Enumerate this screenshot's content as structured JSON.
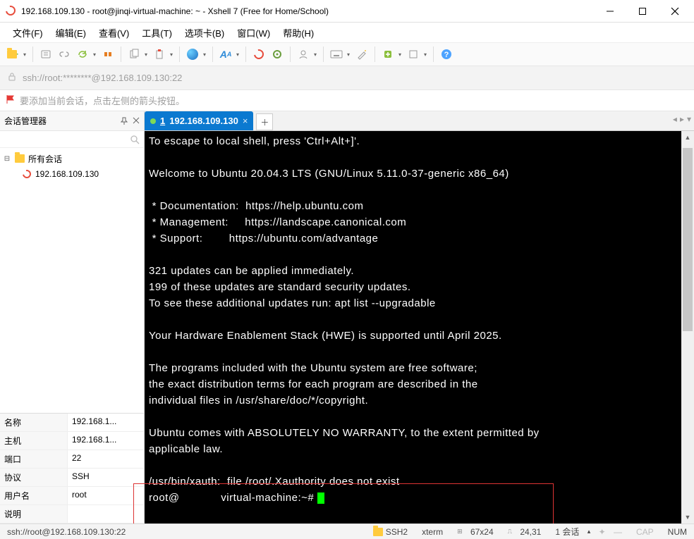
{
  "window": {
    "title": "192.168.109.130 - root@jinqi-virtual-machine: ~ - Xshell 7 (Free for Home/School)"
  },
  "menu": {
    "file": "文件(F)",
    "edit": "编辑(E)",
    "view": "查看(V)",
    "tools": "工具(T)",
    "tab": "选项卡(B)",
    "window": "窗口(W)",
    "help": "帮助(H)"
  },
  "addressbar": {
    "url": "ssh://root:********@192.168.109.130:22"
  },
  "hint": {
    "text": "要添加当前会话，点击左侧的箭头按钮。"
  },
  "sidebar": {
    "title": "会话管理器",
    "root": "所有会话",
    "session": "192.168.109.130"
  },
  "props": {
    "name_k": "名称",
    "name_v": "192.168.1...",
    "host_k": "主机",
    "host_v": "192.168.1...",
    "port_k": "端口",
    "port_v": "22",
    "proto_k": "协议",
    "proto_v": "SSH",
    "user_k": "用户名",
    "user_v": "root",
    "desc_k": "说明",
    "desc_v": ""
  },
  "tab": {
    "index": "1",
    "label": "192.168.109.130"
  },
  "terminal": {
    "line1": "To escape to local shell, press 'Ctrl+Alt+]'.",
    "line2": "",
    "line3": "Welcome to Ubuntu 20.04.3 LTS (GNU/Linux 5.11.0-37-generic x86_64)",
    "line4": "",
    "line5": " * Documentation:  https://help.ubuntu.com",
    "line6": " * Management:     https://landscape.canonical.com",
    "line7": " * Support:        https://ubuntu.com/advantage",
    "line8": "",
    "line9": "321 updates can be applied immediately.",
    "line10": "199 of these updates are standard security updates.",
    "line11": "To see these additional updates run: apt list --upgradable",
    "line12": "",
    "line13": "Your Hardware Enablement Stack (HWE) is supported until April 2025.",
    "line14": "",
    "line15": "The programs included with the Ubuntu system are free software;",
    "line16": "the exact distribution terms for each program are described in the",
    "line17": "individual files in /usr/share/doc/*/copyright.",
    "line18": "",
    "line19": "Ubuntu comes with ABSOLUTELY NO WARRANTY, to the extent permitted by",
    "line20": "applicable law.",
    "line21": "",
    "line22": "/usr/bin/xauth:  file /root/.Xauthority does not exist",
    "prompt_pre": "root@",
    "prompt_post": "virtual-machine:~# "
  },
  "status": {
    "conn": "ssh://root@192.168.109.130:22",
    "proto": "SSH2",
    "term": "xterm",
    "size": "67x24",
    "pos": "24,31",
    "sessions": "1 会话",
    "cap": "CAP",
    "num": "NUM"
  }
}
